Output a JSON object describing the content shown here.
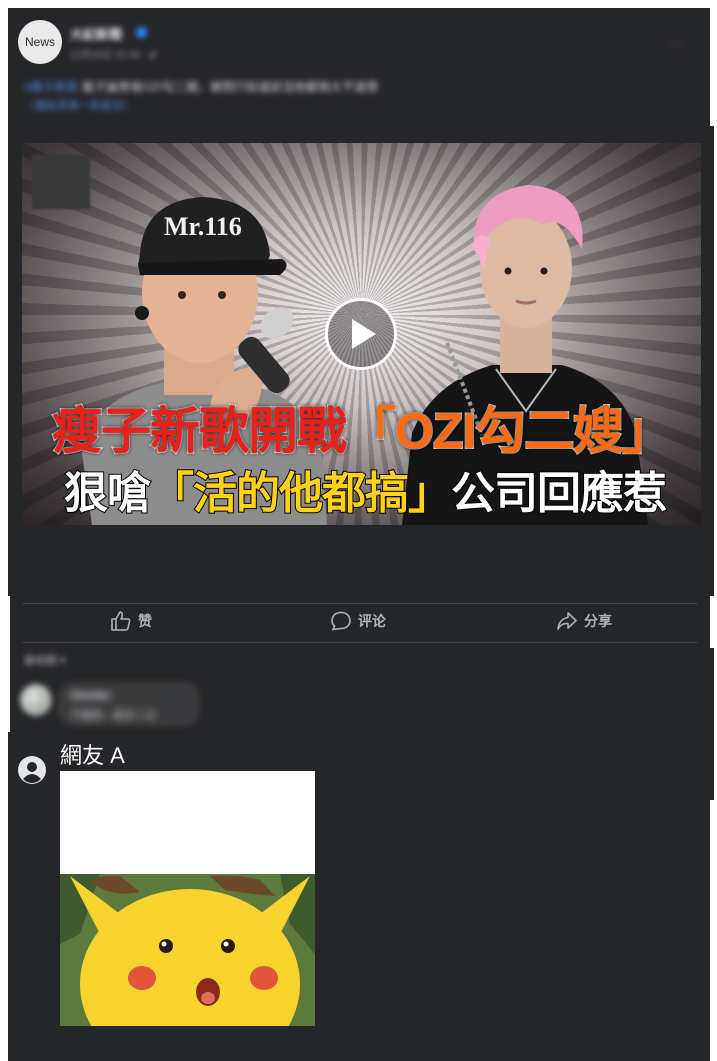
{
  "post": {
    "page_avatar_label": "News",
    "page_name": "大紀新聞",
    "meta": "12月28日 21:40 · ⊕",
    "more_label": "···",
    "text_link": "#瘦子新歌",
    "text": "瘦子論男嗆OZI勾二嫂，被問只知道該活他都搞大不道德",
    "link": "（連結見第一則留言）"
  },
  "video": {
    "headline_line1_red": "瘦子新歌開戰",
    "headline_line1_orange": "「OZI勾二嫂」",
    "headline_line2_white_a": "狠嗆",
    "headline_line2_yellow": "「活的他都搞」",
    "headline_line2_white_b": "公司回應惹",
    "cap_text": "Mr.116",
    "play_icon": "play-icon"
  },
  "actions": {
    "like": "赞",
    "comment": "评论",
    "share": "分享"
  },
  "comments": {
    "sort_label": "最相關 ▾",
    "first": {
      "name": "Shmiter",
      "text": "不確係 · 更多二丈"
    },
    "second": {
      "name": "網友 A"
    }
  },
  "colors": {
    "panel_bg": "#252629",
    "accent_blue": "#2d88ff",
    "headline_red": "#e8221b",
    "headline_orange": "#ff6a13",
    "headline_yellow": "#ffd21a"
  }
}
